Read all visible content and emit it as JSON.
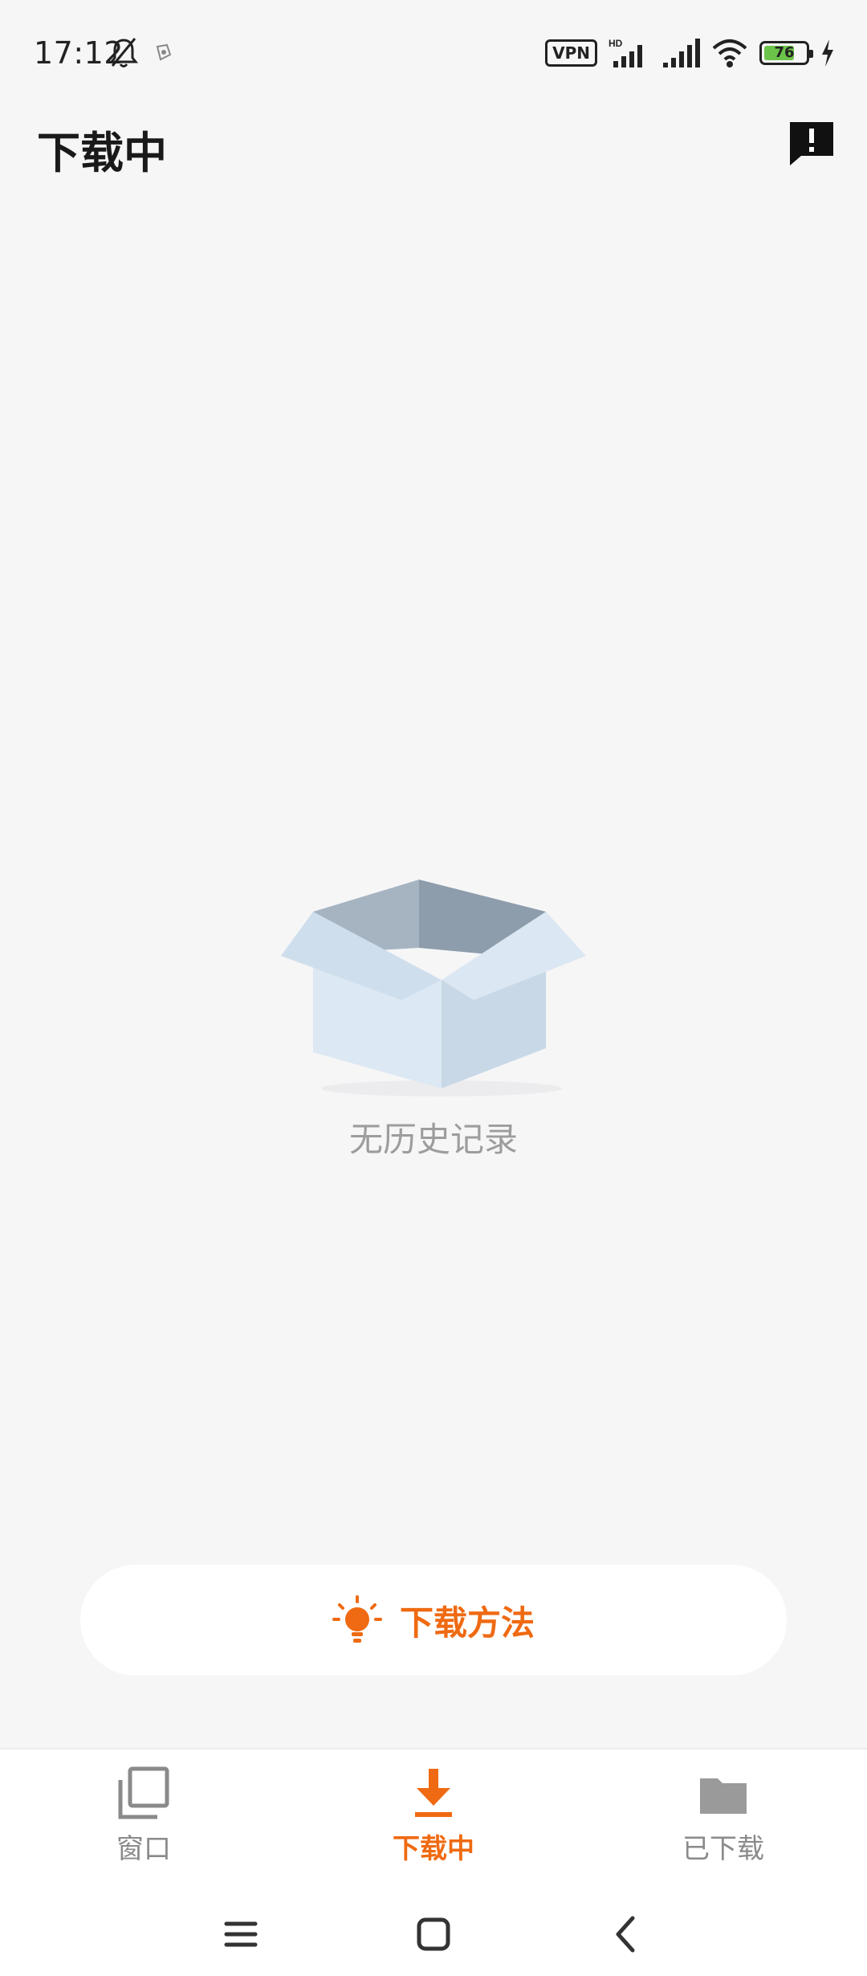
{
  "status_bar": {
    "time": "17:12",
    "vpn": "VPN",
    "network": "HD",
    "battery_level": "76",
    "battery_fraction": 0.76
  },
  "header": {
    "title": "下载中",
    "feedback_icon": "feedback-exclamation-icon"
  },
  "empty_state": {
    "icon": "empty-box-icon",
    "message": "无历史记录"
  },
  "howto_button": {
    "icon": "lightbulb-icon",
    "label": "下载方法"
  },
  "bottom_nav": {
    "items": [
      {
        "label": "窗口",
        "icon": "windows-icon",
        "active": false
      },
      {
        "label": "下载中",
        "icon": "download-icon",
        "active": true
      },
      {
        "label": "已下载",
        "icon": "folder-icon",
        "active": false
      }
    ]
  },
  "system_nav": {
    "menu_icon": "menu-icon",
    "home_icon": "home-icon",
    "back_icon": "back-icon"
  },
  "colors": {
    "accent": "#ef6a12",
    "background": "#f6f6f7",
    "muted_text": "#9d9d9d"
  }
}
